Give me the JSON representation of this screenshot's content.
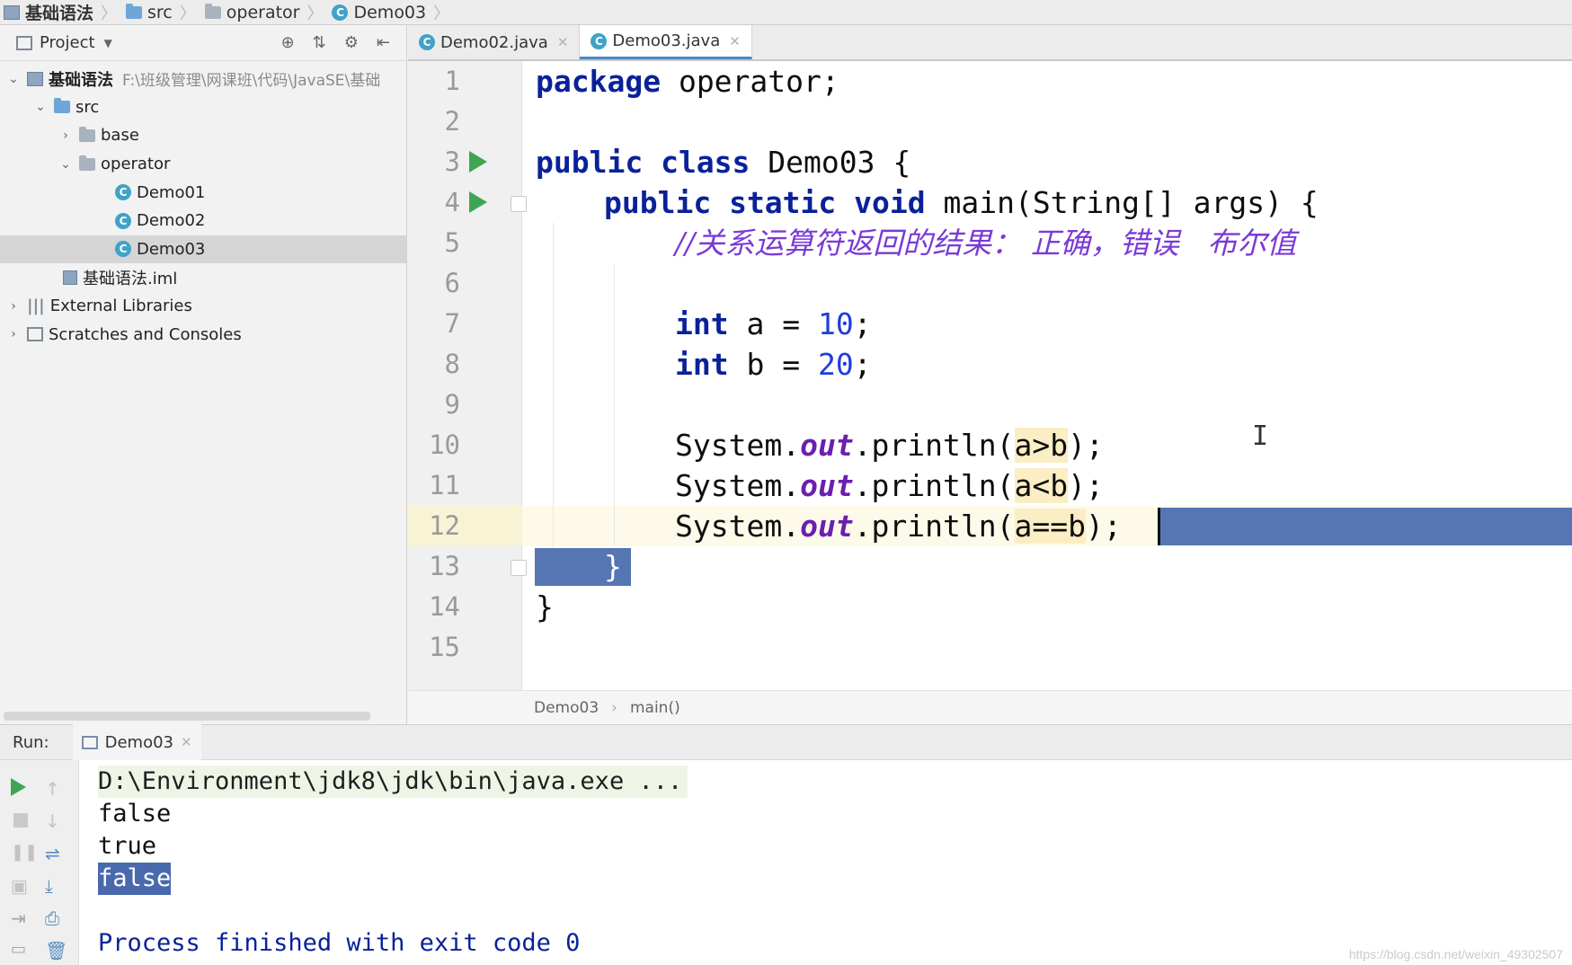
{
  "navbar": {
    "items": [
      {
        "label": "基础语法",
        "icon": "module-icon"
      },
      {
        "label": "src",
        "icon": "folder-icon"
      },
      {
        "label": "operator",
        "icon": "package-icon"
      },
      {
        "label": "Demo03",
        "icon": "class-icon"
      }
    ]
  },
  "project": {
    "header_label": "Project",
    "tree": [
      {
        "label": "基础语法",
        "path": "F:\\班级管理\\网课班\\代码\\JavaSE\\基础"
      },
      {
        "label": "src"
      },
      {
        "label": "base"
      },
      {
        "label": "operator"
      },
      {
        "label": "Demo01"
      },
      {
        "label": "Demo02"
      },
      {
        "label": "Demo03"
      },
      {
        "label": "基础语法.iml"
      },
      {
        "label": "External Libraries"
      },
      {
        "label": "Scratches and Consoles"
      }
    ]
  },
  "tabs": [
    {
      "label": "Demo02.java",
      "active": false
    },
    {
      "label": "Demo03.java",
      "active": true
    }
  ],
  "editor": {
    "line_numbers": [
      "1",
      "2",
      "3",
      "4",
      "5",
      "6",
      "7",
      "8",
      "9",
      "10",
      "11",
      "12",
      "13",
      "14",
      "15"
    ],
    "code": {
      "l1_kw": "package",
      "l1_rest": " operator;",
      "l3_kw": "public class",
      "l3_rest": " Demo03 {",
      "l4_kw": "public static void",
      "l4_rest": " main(String[] args) {",
      "l5_comment": "//关系运算符返回的结果： 正确，错误   布尔值",
      "l7_kw": "int",
      "l7_mid": " a = ",
      "l7_num": "10",
      "l7_end": ";",
      "l8_kw": "int",
      "l8_mid": " b = ",
      "l8_num": "20",
      "l8_end": ";",
      "sys": "System.",
      "out": "out",
      "println": ".println(",
      "l10_arg": "a>b",
      "l11_arg": "a<b",
      "l12_arg": "a==b",
      "close_paren": ");",
      "brace_close": "}"
    },
    "current_line": 12
  },
  "editor_footer": {
    "class_crumb": "Demo03",
    "method_crumb": "main()"
  },
  "run": {
    "label": "Run:",
    "tab_label": "Demo03",
    "console": [
      "D:\\Environment\\jdk8\\jdk\\bin\\java.exe ...",
      "false",
      "true",
      "false",
      "",
      "Process finished with exit code 0"
    ]
  },
  "watermark": "https://blog.csdn.net/weixin_49302507",
  "colors": {
    "keyword": "#0a2199",
    "number": "#1f3de0",
    "comment": "#7a3ad6",
    "selection": "#5576b3",
    "run_green": "#3fa554"
  }
}
